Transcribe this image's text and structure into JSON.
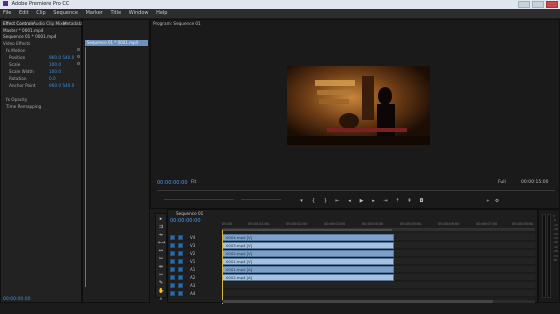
{
  "window": {
    "title": "Adobe Premiere Pro CC"
  },
  "menu": [
    "File",
    "Edit",
    "Clip",
    "Sequence",
    "Marker",
    "Title",
    "Window",
    "Help"
  ],
  "effect_controls": {
    "tabs": [
      "Effect Controls",
      "Audio Clip Mixer",
      "Metadata"
    ],
    "source_label": "Master * 0001.mp4",
    "clip_label": "Sequence 01 * 0001.mp4",
    "rows": [
      {
        "label": "Video Effects"
      },
      {
        "label": "fx Motion"
      },
      {
        "label": "Position",
        "value": "960.0  540.0"
      },
      {
        "label": "Scale",
        "value": "100.0"
      },
      {
        "label": "Scale Width",
        "value": "100.0"
      },
      {
        "label": "Rotation",
        "value": "0.0"
      },
      {
        "label": "Anchor Point",
        "value": "960.0  540.0"
      },
      {
        "label": "fx Opacity"
      },
      {
        "label": "Time Remapping"
      }
    ],
    "status_timecode": "00:00:00:00"
  },
  "program_monitor": {
    "tab": "Program: Sequence 01",
    "timecode": "00:00:00:00",
    "fit": "Fit",
    "quality": "Full",
    "duration": "00:00:15:00"
  },
  "tools": [
    "select-tool",
    "track-select-tool",
    "ripple-edit-tool",
    "rolling-edit-tool",
    "rate-stretch-tool",
    "razor-tool",
    "slip-tool",
    "slide-tool",
    "pen-tool",
    "hand-tool",
    "zoom-tool"
  ],
  "timeline": {
    "tab": "Sequence 01",
    "timecode": "00:00:00:00",
    "ruler": [
      "00:00",
      "00:00:01:00",
      "00:00:02:00",
      "00:00:03:00",
      "00:00:04:00",
      "00:00:05:00",
      "00:00:06:00",
      "00:00:07:00",
      "00:00:08:00"
    ],
    "tracks": [
      {
        "name": "V4",
        "clip": "0004.mp4 [V]"
      },
      {
        "name": "V3",
        "clip": "0003.mp4 [V]"
      },
      {
        "name": "V2",
        "clip": "0002.mp4 [V]"
      },
      {
        "name": "V1",
        "clip": "0001.mp4 [V]"
      },
      {
        "name": "A1",
        "clip": "0001.mp4 [A]"
      },
      {
        "name": "A2",
        "clip": "0002.mp4 [A]"
      },
      {
        "name": "A3",
        "clip": ""
      },
      {
        "name": "A4",
        "clip": ""
      }
    ]
  },
  "meters": {
    "scale": [
      "0",
      "-6",
      "-12",
      "-18",
      "-24",
      "-30",
      "-36",
      "-42",
      "-48",
      "-54",
      "dB"
    ]
  }
}
